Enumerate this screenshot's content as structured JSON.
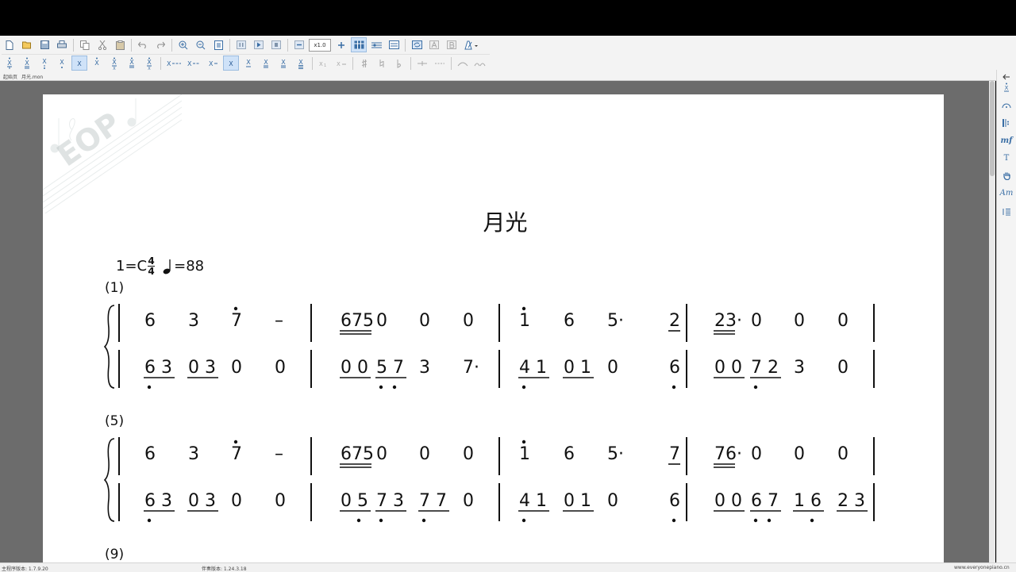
{
  "toolbar": {
    "zoom_value": "x1.0",
    "row1_icons": [
      "new-file-icon",
      "open-file-icon",
      "save-icon",
      "print-icon",
      "copy-icon",
      "cut-icon",
      "paste-icon",
      "undo-icon",
      "redo-icon",
      "zoom-in-icon",
      "zoom-out-icon",
      "fit-page-icon",
      "pause-icon",
      "play-icon",
      "stop-icon",
      "zoom-decrease-icon",
      "zoom-increase-icon",
      "layout-icon",
      "staff-icon",
      "staff-alt-icon",
      "sync-icon",
      "font-icon",
      "bold-icon",
      "metronome-icon"
    ],
    "row2_icons": [
      "dot-above-icon",
      "dot-above-2-icon",
      "dot-below-icon",
      "dot-below-2-icon",
      "note-plain-icon",
      "underline-1-icon",
      "underline-2-icon",
      "underline-3-icon",
      "underline-4-icon",
      "dash-long-icon",
      "dash-medium-icon",
      "dash-short-icon",
      "note-active-icon",
      "underline-a-icon",
      "underline-b-icon",
      "underline-c-icon",
      "underline-d-icon",
      "grace-1-icon",
      "grace-2-icon",
      "sharp-icon",
      "natural-icon",
      "flat-icon",
      "tie-icon",
      "slur-dash-icon",
      "arc-icon",
      "repeat-arc-icon"
    ]
  },
  "tabs": {
    "home": "起始页",
    "file": "月光.mon"
  },
  "score": {
    "title": "月光",
    "key": "1=C",
    "time_top": "4",
    "time_bottom": "4",
    "tempo": "=88",
    "system1_number": "(1)",
    "system2_number": "(5)",
    "system3_number": "(9)",
    "systems": [
      {
        "upper": [
          [
            "6",
            "3",
            "7",
            "–"
          ],
          [
            "675",
            "0",
            "0",
            "0"
          ],
          [
            "1",
            "6",
            "5·",
            "2"
          ],
          [
            "23·",
            "0",
            "0",
            "0"
          ]
        ],
        "lower": [
          [
            "6 3",
            "0 3",
            "0",
            "0"
          ],
          [
            "0 0",
            "5 7",
            "3",
            "7·"
          ],
          [
            "4 1",
            "0 1",
            "0",
            "6"
          ],
          [
            "0 0",
            "7 2",
            "3",
            "0"
          ]
        ]
      },
      {
        "upper": [
          [
            "6",
            "3",
            "7",
            "–"
          ],
          [
            "675",
            "0",
            "0",
            "0"
          ],
          [
            "1",
            "6",
            "5·",
            "7"
          ],
          [
            "76·",
            "0",
            "0",
            "0"
          ]
        ],
        "lower": [
          [
            "6 3",
            "0 3",
            "0",
            "0"
          ],
          [
            "0 5",
            "7 3",
            "7 7",
            "0"
          ],
          [
            "4 1",
            "0 1",
            "0",
            "6"
          ],
          [
            "0 0",
            "6 7",
            "1 6",
            "2 3"
          ]
        ]
      }
    ]
  },
  "right_panel": {
    "icons": [
      "back-arrow-icon",
      "dot-note-icon",
      "fermata-icon",
      "repeat-icon",
      "dynamics-icon",
      "text-icon",
      "hand-icon",
      "chord-icon",
      "indent-icon"
    ],
    "dynamics_label": "mf",
    "text_label": "T",
    "chord_label": "Am"
  },
  "status": {
    "left": "主程序版本: 1.7.9.20",
    "mid": "伴奏版本: 1.24.3.18",
    "right": "www.everyonepiano.cn"
  }
}
